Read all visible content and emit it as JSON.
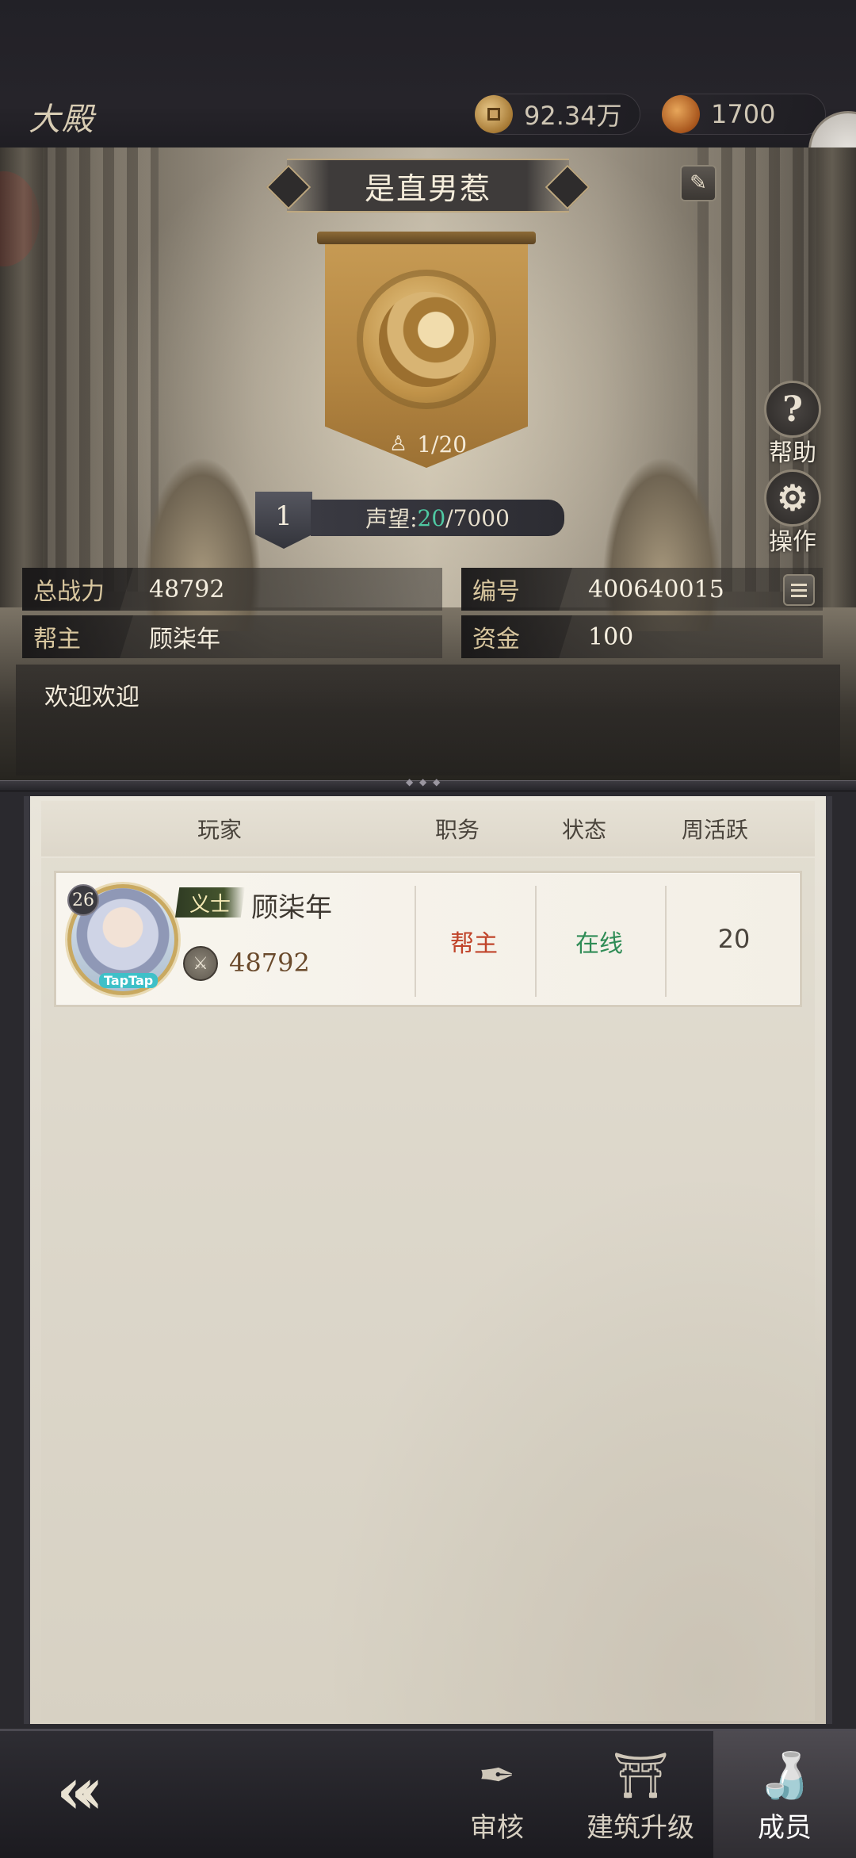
{
  "header": {
    "hall_title": "大殿",
    "coins": "92.34万",
    "tokens": "1700",
    "coin_icon": "copper-coin-icon",
    "token_icon": "token-icon"
  },
  "guild": {
    "name": "是直男惹",
    "member_count": "1/20",
    "level": "1",
    "prestige_label": "声望:",
    "prestige_current": "20",
    "prestige_max": "/7000",
    "notice": "欢迎欢迎"
  },
  "side_buttons": {
    "help_label": "帮助",
    "operate_label": "操作"
  },
  "info": {
    "power_key": "总战力",
    "power_val": "48792",
    "id_key": "编号",
    "id_val": "400640015",
    "leader_key": "帮主",
    "leader_val": "顾柒年",
    "funds_key": "资金",
    "funds_val": "100"
  },
  "table": {
    "headers": {
      "player": "玩家",
      "role": "职务",
      "state": "状态",
      "weekly_active": "周活跃"
    },
    "rows": [
      {
        "level": "26",
        "title": "义士",
        "name": "顾柒年",
        "power": "48792",
        "role": "帮主",
        "state": "在线",
        "weekly_active": "20",
        "badge": "TapTap"
      }
    ]
  },
  "bottom_nav": {
    "tabs": [
      {
        "label": "审核"
      },
      {
        "label": "建筑升级"
      },
      {
        "label": "成员"
      }
    ],
    "active": "成员"
  },
  "colors": {
    "prestige_accent": "#4fc9a3",
    "role_red": "#c0442a",
    "online_green": "#2f8c56"
  }
}
